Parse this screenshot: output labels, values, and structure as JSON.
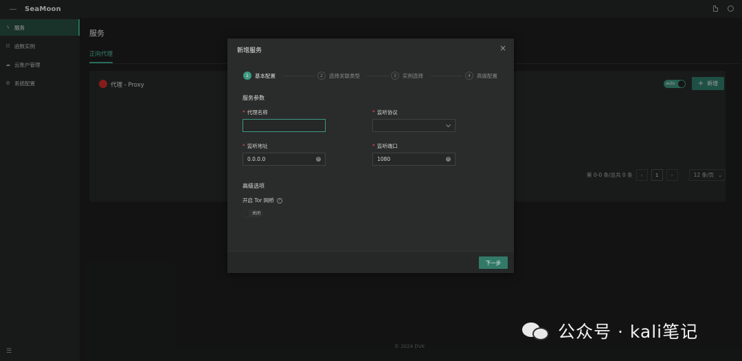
{
  "topbar": {
    "app_title": "SeaMoon"
  },
  "sidebar": {
    "items": [
      {
        "label": "服务",
        "icon": "bolt-icon",
        "active": true
      },
      {
        "label": "函数实例",
        "icon": "server-icon",
        "active": false
      },
      {
        "label": "云账户管理",
        "icon": "cloud-icon",
        "active": false
      },
      {
        "label": "系统配置",
        "icon": "gear-icon",
        "active": false
      }
    ]
  },
  "main": {
    "page_title": "服务",
    "tab": "正向代理",
    "card": {
      "proxy_title": "代理 - Proxy",
      "auto_label": "auto",
      "add_label": "新增"
    },
    "pager": {
      "summary": "第 0-0 条/总共 0 条",
      "current_page": "1",
      "page_size": "12 条/页"
    },
    "footer": "© 2024 DVK"
  },
  "modal": {
    "title": "新增服务",
    "steps": [
      {
        "num": "1",
        "label": "基本配置"
      },
      {
        "num": "2",
        "label": "选择关联类型"
      },
      {
        "num": "3",
        "label": "实例选择"
      },
      {
        "num": "4",
        "label": "高级配置"
      }
    ],
    "section_params": "服务参数",
    "fields": {
      "proxy_name": {
        "label": "代理名称",
        "value": ""
      },
      "listen_protocol": {
        "label": "监听协议",
        "value": ""
      },
      "listen_address": {
        "label": "监听地址",
        "value": "0.0.0.0"
      },
      "listen_port": {
        "label": "监听端口",
        "value": "1080"
      }
    },
    "section_advanced": "高级选项",
    "tor": {
      "label": "开启 Tor 网桥",
      "switch_label": "关闭"
    },
    "next_label": "下一步"
  },
  "watermark": {
    "text": "公众号 · kali笔记"
  },
  "colors": {
    "accent": "#3d9a82",
    "required": "#e05050"
  }
}
